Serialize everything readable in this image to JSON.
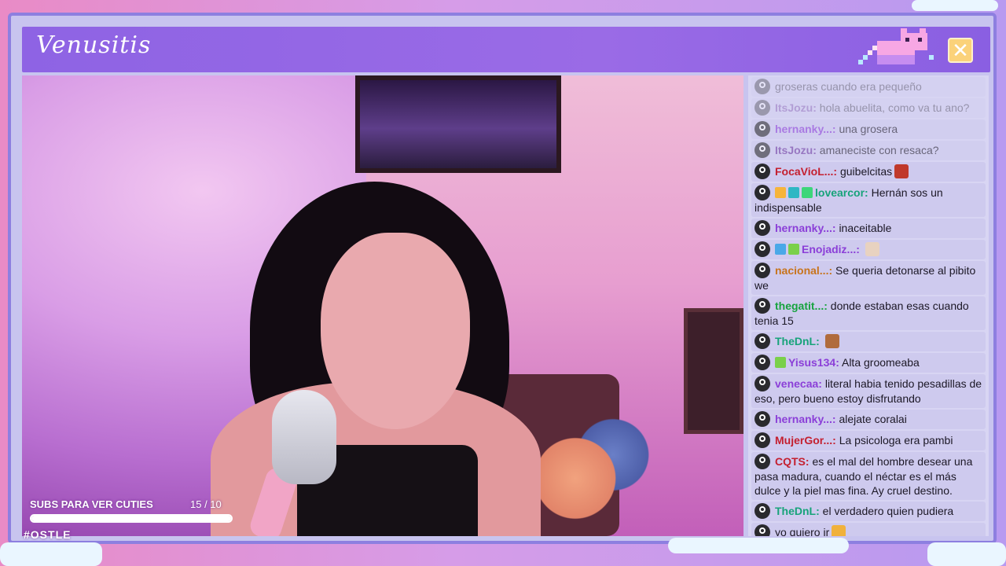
{
  "app": {
    "title": "Venusitis"
  },
  "colors": {
    "accent": "#9a6be6",
    "frame": "#8d7fe0",
    "close_button": "#fbd27a",
    "goal_fill": "#ffffff"
  },
  "goal": {
    "label": "SUBS PARA VER CUTIES",
    "count": "15 / 10",
    "progress_fraction": 1.0
  },
  "hashtag": "#OSTLE",
  "chat": {
    "messages": [
      {
        "user": "",
        "text": "groseras cuando era pequeño",
        "user_color": "#6c3aa0",
        "state": "faded",
        "badges": [],
        "emote": null
      },
      {
        "user": "ItsJozu:",
        "text": "hola abuelita, como va tu ano?",
        "user_color": "#6c3aa0",
        "state": "faded",
        "badges": [],
        "emote": null
      },
      {
        "user": "hernanky...:",
        "text": "una grosera",
        "user_color": "#8b3fd8",
        "state": "fade2",
        "badges": [],
        "emote": null
      },
      {
        "user": "ItsJozu:",
        "text": "amaneciste con resaca?",
        "user_color": "#6c3aa0",
        "state": "fade2",
        "badges": [],
        "emote": null
      },
      {
        "user": "FocaVioL...:",
        "text": "guibelcitas",
        "user_color": "#c41f2f",
        "state": "",
        "badges": [],
        "emote": "devil-emote"
      },
      {
        "user": "lovearcor:",
        "text": "Hernán sos un indispensable",
        "user_color": "#17a37a",
        "state": "",
        "badges": [
          "#f6b43b",
          "#2fb7c4",
          "#3dd67a"
        ],
        "emote": null
      },
      {
        "user": "hernanky...:",
        "text": "inaceitable",
        "user_color": "#8b3fd8",
        "state": "",
        "badges": [],
        "emote": null
      },
      {
        "user": "Enojadiz...:",
        "text": "",
        "user_color": "#8b3fd8",
        "state": "",
        "badges": [
          "#4aa8e8",
          "#7ad04a"
        ],
        "emote": "face-emote"
      },
      {
        "user": "nacional...:",
        "text": "Se queria detonarse al pibito we",
        "user_color": "#c8741c",
        "state": "",
        "badges": [],
        "emote": null
      },
      {
        "user": "thegatit...:",
        "text": "donde estaban esas cuando tenia 15",
        "user_color": "#17a33e",
        "state": "",
        "badges": [],
        "emote": null
      },
      {
        "user": "TheDnL:",
        "text": "",
        "user_color": "#17a37a",
        "state": "",
        "badges": [],
        "emote": "face-emote-2"
      },
      {
        "user": "Yisus134:",
        "text": "Alta groomeaba",
        "user_color": "#8b3fd8",
        "state": "",
        "badges": [
          "#7ad04a"
        ],
        "emote": null
      },
      {
        "user": "venecaa:",
        "text": "literal habia tenido pesadillas de eso, pero bueno estoy disfrutando",
        "user_color": "#8b3fd8",
        "state": "",
        "badges": [],
        "emote": null
      },
      {
        "user": "hernanky...:",
        "text": "alejate coralai",
        "user_color": "#8b3fd8",
        "state": "",
        "badges": [],
        "emote": null
      },
      {
        "user": "MujerGor...:",
        "text": "La psicologa era pambi",
        "user_color": "#c41f2f",
        "state": "",
        "badges": [],
        "emote": null
      },
      {
        "user": "CQTS:",
        "text": "es el mal del hombre desear una pasa madura, cuando el néctar es el más dulce y la piel mas fina. Ay cruel destino.",
        "user_color": "#c41f2f",
        "state": "",
        "badges": [],
        "emote": null
      },
      {
        "user": "TheDnL:",
        "text": "el verdadero quien pudiera",
        "user_color": "#17a37a",
        "state": "",
        "badges": [],
        "emote": null
      },
      {
        "user": "",
        "text": "yo quiero ir",
        "user_color": "#1c1826",
        "state": "",
        "badges": [],
        "emote": "cat-emote"
      }
    ]
  },
  "icons": {
    "close": "close-icon",
    "mascot": "pixel-cat-icon"
  }
}
